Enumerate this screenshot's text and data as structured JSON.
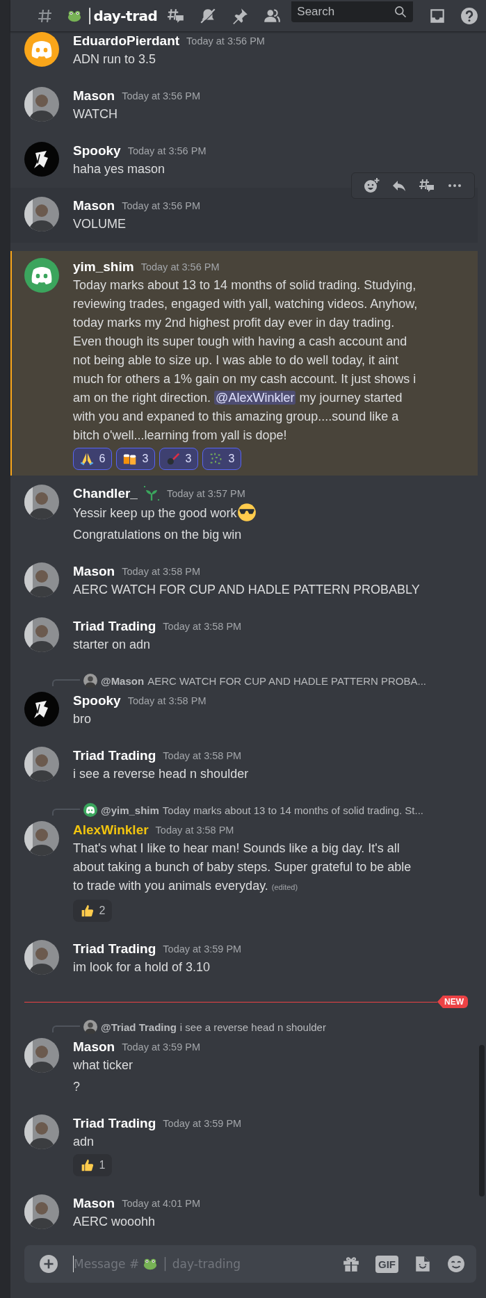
{
  "header": {
    "channel_name": "│day-trad",
    "search": {
      "placeholder": "Search"
    }
  },
  "messages": [
    {
      "author": "EduardoPierdant",
      "color": "#ffffff",
      "time": "Today at 3:56 PM",
      "avatar": {
        "kind": "logo",
        "color": "#faa61a"
      },
      "lines": [
        {
          "parts": [
            {
              "kind": "text",
              "text": "ADN run to 3.5"
            }
          ]
        }
      ]
    },
    {
      "author": "Mason",
      "color": "#ffffff",
      "time": "Today at 3:56 PM",
      "avatar": {
        "kind": "photo"
      },
      "lines": [
        {
          "parts": [
            {
              "kind": "text",
              "text": "WATCH"
            }
          ]
        }
      ]
    },
    {
      "author": "Spooky",
      "color": "#ffffff",
      "time": "Today at 3:56 PM",
      "avatar": {
        "kind": "dark"
      },
      "lines": [
        {
          "parts": [
            {
              "kind": "text",
              "text": "haha yes mason"
            }
          ]
        }
      ]
    },
    {
      "author": "Mason",
      "color": "#ffffff",
      "time": "Today at 3:56 PM",
      "avatar": {
        "kind": "photo"
      },
      "hovered": true,
      "lines": [
        {
          "parts": [
            {
              "kind": "text",
              "text": "VOLUME"
            }
          ]
        }
      ]
    },
    {
      "author": "yim_shim",
      "color": "#ffffff",
      "time": "Today at 3:56 PM",
      "avatar": {
        "kind": "logo",
        "color": "#3ba55d"
      },
      "highlighted": true,
      "lines": [
        {
          "parts": [
            {
              "kind": "text",
              "text": "Today marks about 13 to 14 months of solid trading. Studying, reviewing trades, engaged with yall, watching videos. Anyhow, today marks my 2nd highest profit day ever in day trading. Even though its super tough with having a cash account and not being able to size up. I was able to do well today, it aint much for others a 1% gain on my cash account. It just shows i am on the right direction. "
            },
            {
              "kind": "mention",
              "text": "@AlexWinkler"
            },
            {
              "kind": "text",
              "text": " my journey started with you and expaned to this amazing group....sound like a bitch o'well...learning from yall is dope!"
            }
          ]
        }
      ],
      "reactions": [
        {
          "kind": "pray",
          "count": "6",
          "selected": true
        },
        {
          "kind": "beers",
          "count": "3",
          "selected": true
        },
        {
          "kind": "horn",
          "count": "3",
          "selected": true
        },
        {
          "kind": "confetti",
          "count": "3",
          "selected": true
        }
      ]
    },
    {
      "author": "Chandler_",
      "color": "#ffffff",
      "time": "Today at 3:57 PM",
      "avatar": {
        "kind": "photo"
      },
      "badge": true,
      "lines": [
        {
          "parts": [
            {
              "kind": "text",
              "text": "Yessir keep up the good work"
            },
            {
              "kind": "sunglasses"
            }
          ]
        },
        {
          "parts": [
            {
              "kind": "text",
              "text": "Congratulations on the big win"
            }
          ]
        }
      ]
    },
    {
      "author": "Mason",
      "color": "#ffffff",
      "time": "Today at 3:58 PM",
      "avatar": {
        "kind": "photo"
      },
      "lines": [
        {
          "parts": [
            {
              "kind": "text",
              "text": "AERC WATCH FOR CUP AND HADLE PATTERN PROBABLY"
            }
          ]
        }
      ]
    },
    {
      "author": "Triad Trading",
      "color": "#ffffff",
      "time": "Today at 3:58 PM",
      "avatar": {
        "kind": "photo"
      },
      "lines": [
        {
          "parts": [
            {
              "kind": "text",
              "text": "starter on adn"
            }
          ]
        }
      ]
    },
    {
      "author": "Spooky",
      "color": "#ffffff",
      "time": "Today at 3:58 PM",
      "avatar": {
        "kind": "dark"
      },
      "reply": {
        "author": "@Mason",
        "text": "AERC WATCH FOR CUP AND HADLE PATTERN PROBA...",
        "avatar": {
          "kind": "photo"
        }
      },
      "lines": [
        {
          "parts": [
            {
              "kind": "text",
              "text": "bro"
            }
          ]
        }
      ]
    },
    {
      "author": "Triad Trading",
      "color": "#ffffff",
      "time": "Today at 3:58 PM",
      "avatar": {
        "kind": "photo"
      },
      "lines": [
        {
          "parts": [
            {
              "kind": "text",
              "text": "i see a reverse head n shoulder"
            }
          ]
        }
      ]
    },
    {
      "author": "AlexWinkler",
      "color": "#f1c40f",
      "time": "Today at 3:58 PM",
      "avatar": {
        "kind": "photo"
      },
      "reply": {
        "author": "@yim_shim",
        "text": "Today marks about 13 to 14 months of solid trading. St...",
        "avatar": {
          "kind": "logo",
          "color": "#3ba55d"
        }
      },
      "lines": [
        {
          "parts": [
            {
              "kind": "text",
              "text": "That's what I like to hear man! Sounds like a big day. It's all about taking a bunch of baby steps. Super grateful to be able to trade with you animals everyday. "
            },
            {
              "kind": "edited",
              "text": "(edited)"
            }
          ]
        }
      ],
      "reactions": [
        {
          "kind": "thumbs",
          "count": "2",
          "selected": false
        }
      ]
    },
    {
      "author": "Triad Trading",
      "color": "#ffffff",
      "time": "Today at 3:59 PM",
      "avatar": {
        "kind": "photo"
      },
      "lines": [
        {
          "parts": [
            {
              "kind": "text",
              "text": "im look for a hold of 3.10"
            }
          ]
        }
      ]
    },
    {
      "author": "Mason",
      "color": "#ffffff",
      "time": "Today at 3:59 PM",
      "avatar": {
        "kind": "photo"
      },
      "divider": "NEW",
      "reply": {
        "author": "@Triad Trading",
        "text": "i see a reverse head n shoulder",
        "avatar": {
          "kind": "photo"
        }
      },
      "lines": [
        {
          "parts": [
            {
              "kind": "text",
              "text": "what ticker"
            }
          ]
        },
        {
          "parts": [
            {
              "kind": "text",
              "text": "?"
            }
          ]
        }
      ]
    },
    {
      "author": "Triad Trading",
      "color": "#ffffff",
      "time": "Today at 3:59 PM",
      "avatar": {
        "kind": "photo"
      },
      "lines": [
        {
          "parts": [
            {
              "kind": "text",
              "text": "adn"
            }
          ]
        }
      ],
      "reactions": [
        {
          "kind": "thumbs",
          "count": "1",
          "selected": false
        }
      ]
    },
    {
      "author": "Mason",
      "color": "#ffffff",
      "time": "Today at 4:01 PM",
      "avatar": {
        "kind": "photo"
      },
      "lines": [
        {
          "parts": [
            {
              "kind": "text",
              "text": "AERC wooohh"
            }
          ]
        }
      ]
    }
  ],
  "composer": {
    "hint_start": "Message #",
    "hint_channel": "│ day-trading",
    "gif_label": "GIF"
  }
}
